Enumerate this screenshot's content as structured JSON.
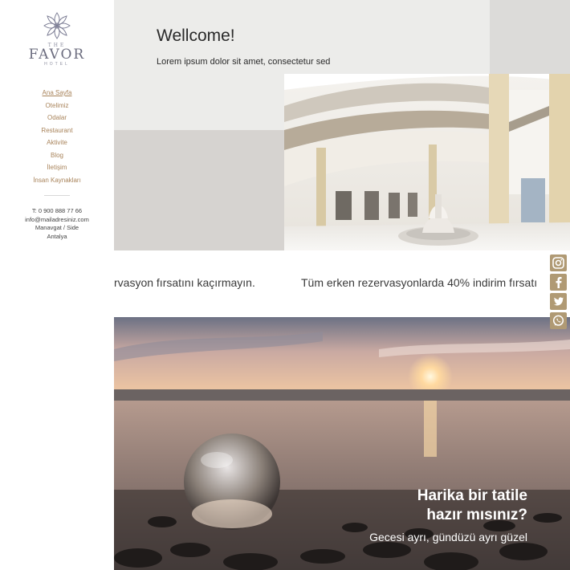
{
  "logo": {
    "the": "THE",
    "name": "FAVOR",
    "hotel": "HOTEL"
  },
  "menu": [
    {
      "label": "Ana Sayfa",
      "active": true
    },
    {
      "label": "Otelimiz"
    },
    {
      "label": "Odalar"
    },
    {
      "label": "Restaurant"
    },
    {
      "label": "Aktivite"
    },
    {
      "label": "Blog"
    },
    {
      "label": "İletişim"
    },
    {
      "label": "İnsan Kaynakları"
    }
  ],
  "contact": {
    "phone": "T: 0 900 888 77 66",
    "email": "info@mailadresiniz.com",
    "city": "Manavgat / Side",
    "region": "Antalya"
  },
  "hero": {
    "title": "Wellcome!",
    "subtitle": "Lorem ipsum dolor sit amet, consectetur sed"
  },
  "marquee": {
    "part1": "rvasyon fırsatını kaçırmayın.",
    "part2": "Tüm erken rezervasyonlarda 40% indirim fırsatı"
  },
  "promo": {
    "line1": "Harika bir tatile",
    "line2": "hazır mısınız?",
    "line3": "Gecesi ayrı, gündüzü ayrı güzel"
  },
  "social": [
    "instagram-icon",
    "facebook-icon",
    "twitter-icon",
    "whatsapp-icon"
  ],
  "colors": {
    "accent": "#a8835a",
    "social_bg": "#b09a74"
  }
}
